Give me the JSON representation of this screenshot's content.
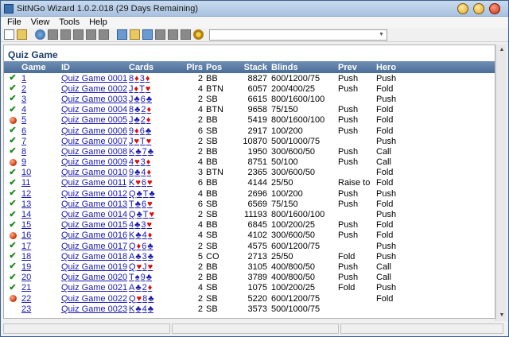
{
  "window": {
    "title": "SitNGo Wizard 1.0.2.018 (29 Days Remaining)"
  },
  "menu": [
    "File",
    "View",
    "Tools",
    "Help"
  ],
  "toolbar_icons": [
    "new-doc-icon",
    "open-folder-icon",
    "globe-icon",
    "gray-icon",
    "gray-icon",
    "gray-icon",
    "gray-icon",
    "gray-icon",
    "copy-icon",
    "paste-icon",
    "image-icon",
    "gray-icon",
    "gray-icon",
    "edit-icon",
    "gear-icon"
  ],
  "combo": {
    "value": ""
  },
  "panel": {
    "title": "Quiz Game"
  },
  "columns": {
    "game": "Game",
    "id": "ID",
    "cards": "Cards",
    "plrs": "Plrs",
    "pos": "Pos",
    "stack": "Stack",
    "blinds": "Blinds",
    "prev": "Prev",
    "hero": "Hero"
  },
  "colors": {
    "header_bg": "#5b7ca8",
    "check": "#1e8a1e",
    "wrong": "#d04010",
    "link": "#1a1ab0",
    "red_suit": "#d81010"
  },
  "rows": [
    {
      "status": "correct",
      "game": "1",
      "id": "Quiz Game 0001",
      "c1": "8",
      "s1": "♦",
      "c2": "3",
      "s2": "♦",
      "plrs": "2",
      "pos": "BB",
      "stack": "8827",
      "blinds": "600/1200/75",
      "prev": "Push",
      "hero": "Push"
    },
    {
      "status": "correct",
      "game": "2",
      "id": "Quiz Game 0002",
      "c1": "J",
      "s1": "♦",
      "c2": "T",
      "s2": "♥",
      "plrs": "4",
      "pos": "BTN",
      "stack": "6057",
      "blinds": "200/400/25",
      "prev": "Push",
      "hero": "Fold"
    },
    {
      "status": "correct",
      "game": "3",
      "id": "Quiz Game 0003",
      "c1": "J",
      "s1": "♣",
      "c2": "6",
      "s2": "♣",
      "plrs": "2",
      "pos": "SB",
      "stack": "6615",
      "blinds": "800/1600/100",
      "prev": "",
      "hero": "Push"
    },
    {
      "status": "correct",
      "game": "4",
      "id": "Quiz Game 0004",
      "c1": "8",
      "s1": "♣",
      "c2": "2",
      "s2": "♦",
      "plrs": "4",
      "pos": "BTN",
      "stack": "9658",
      "blinds": "75/150",
      "prev": "Push",
      "hero": "Fold"
    },
    {
      "status": "wrong",
      "game": "5",
      "id": "Quiz Game 0005",
      "c1": "J",
      "s1": "♣",
      "c2": "2",
      "s2": "♦",
      "plrs": "2",
      "pos": "BB",
      "stack": "5419",
      "blinds": "800/1600/100",
      "prev": "Push",
      "hero": "Fold"
    },
    {
      "status": "correct",
      "game": "6",
      "id": "Quiz Game 0006",
      "c1": "9",
      "s1": "♦",
      "c2": "6",
      "s2": "♣",
      "plrs": "6",
      "pos": "SB",
      "stack": "2917",
      "blinds": "100/200",
      "prev": "Push",
      "hero": "Fold"
    },
    {
      "status": "correct",
      "game": "7",
      "id": "Quiz Game 0007",
      "c1": "J",
      "s1": "♥",
      "c2": "T",
      "s2": "♥",
      "plrs": "2",
      "pos": "SB",
      "stack": "10870",
      "blinds": "500/1000/75",
      "prev": "",
      "hero": "Push"
    },
    {
      "status": "correct",
      "game": "8",
      "id": "Quiz Game 0008",
      "c1": "K",
      "s1": "♣",
      "c2": "7",
      "s2": "♣",
      "plrs": "2",
      "pos": "BB",
      "stack": "1950",
      "blinds": "300/600/50",
      "prev": "Push",
      "hero": "Call"
    },
    {
      "status": "wrong",
      "game": "9",
      "id": "Quiz Game 0009",
      "c1": "4",
      "s1": "♥",
      "c2": "3",
      "s2": "♦",
      "plrs": "4",
      "pos": "BB",
      "stack": "8751",
      "blinds": "50/100",
      "prev": "Push",
      "hero": "Call"
    },
    {
      "status": "correct",
      "game": "10",
      "id": "Quiz Game 0010",
      "c1": "9",
      "s1": "♣",
      "c2": "4",
      "s2": "♦",
      "plrs": "3",
      "pos": "BTN",
      "stack": "2365",
      "blinds": "300/600/50",
      "prev": "",
      "hero": "Fold"
    },
    {
      "status": "correct",
      "game": "11",
      "id": "Quiz Game 0011",
      "c1": "K",
      "s1": "♥",
      "c2": "6",
      "s2": "♥",
      "plrs": "6",
      "pos": "BB",
      "stack": "4144",
      "blinds": "25/50",
      "prev": "Raise to",
      "hero": "Fold"
    },
    {
      "status": "correct",
      "game": "12",
      "id": "Quiz Game 0012",
      "c1": "Q",
      "s1": "♣",
      "c2": "T",
      "s2": "♣",
      "plrs": "4",
      "pos": "BB",
      "stack": "2696",
      "blinds": "100/200",
      "prev": "Push",
      "hero": "Push"
    },
    {
      "status": "correct",
      "game": "13",
      "id": "Quiz Game 0013",
      "c1": "T",
      "s1": "♣",
      "c2": "6",
      "s2": "♥",
      "plrs": "6",
      "pos": "SB",
      "stack": "6569",
      "blinds": "75/150",
      "prev": "Push",
      "hero": "Fold"
    },
    {
      "status": "correct",
      "game": "14",
      "id": "Quiz Game 0014",
      "c1": "Q",
      "s1": "♣",
      "c2": "T",
      "s2": "♥",
      "plrs": "2",
      "pos": "SB",
      "stack": "11193",
      "blinds": "800/1600/100",
      "prev": "",
      "hero": "Push"
    },
    {
      "status": "correct",
      "game": "15",
      "id": "Quiz Game 0015",
      "c1": "4",
      "s1": "♣",
      "c2": "3",
      "s2": "♥",
      "plrs": "4",
      "pos": "BB",
      "stack": "6845",
      "blinds": "100/200/25",
      "prev": "Push",
      "hero": "Fold"
    },
    {
      "status": "wrong",
      "game": "16",
      "id": "Quiz Game 0016",
      "c1": "K",
      "s1": "♣",
      "c2": "4",
      "s2": "♦",
      "plrs": "4",
      "pos": "SB",
      "stack": "4102",
      "blinds": "300/600/50",
      "prev": "Push",
      "hero": "Fold"
    },
    {
      "status": "correct",
      "game": "17",
      "id": "Quiz Game 0017",
      "c1": "Q",
      "s1": "♦",
      "c2": "6",
      "s2": "♣",
      "plrs": "2",
      "pos": "SB",
      "stack": "4575",
      "blinds": "600/1200/75",
      "prev": "",
      "hero": "Push"
    },
    {
      "status": "correct",
      "game": "18",
      "id": "Quiz Game 0018",
      "c1": "A",
      "s1": "♣",
      "c2": "3",
      "s2": "♣",
      "plrs": "5",
      "pos": "CO",
      "stack": "2713",
      "blinds": "25/50",
      "prev": "Fold",
      "hero": "Push"
    },
    {
      "status": "correct",
      "game": "19",
      "id": "Quiz Game 0019",
      "c1": "Q",
      "s1": "♥",
      "c2": "J",
      "s2": "♥",
      "plrs": "2",
      "pos": "BB",
      "stack": "3105",
      "blinds": "400/800/50",
      "prev": "Push",
      "hero": "Call"
    },
    {
      "status": "correct",
      "game": "20",
      "id": "Quiz Game 0020",
      "c1": "T",
      "s1": "♠",
      "c2": "9",
      "s2": "♣",
      "plrs": "2",
      "pos": "BB",
      "stack": "3789",
      "blinds": "400/800/50",
      "prev": "Push",
      "hero": "Call"
    },
    {
      "status": "correct",
      "game": "21",
      "id": "Quiz Game 0021",
      "c1": "A",
      "s1": "♣",
      "c2": "2",
      "s2": "♦",
      "plrs": "4",
      "pos": "SB",
      "stack": "1075",
      "blinds": "100/200/25",
      "prev": "Fold",
      "hero": "Push"
    },
    {
      "status": "wrong",
      "game": "22",
      "id": "Quiz Game 0022",
      "c1": "Q",
      "s1": "♥",
      "c2": "8",
      "s2": "♣",
      "plrs": "2",
      "pos": "SB",
      "stack": "5220",
      "blinds": "600/1200/75",
      "prev": "",
      "hero": "Fold"
    },
    {
      "status": "none",
      "game": "23",
      "id": "Quiz Game 0023",
      "c1": "K",
      "s1": "♣",
      "c2": "4",
      "s2": "♣",
      "plrs": "2",
      "pos": "SB",
      "stack": "3573",
      "blinds": "500/1000/75",
      "prev": "",
      "hero": ""
    }
  ]
}
